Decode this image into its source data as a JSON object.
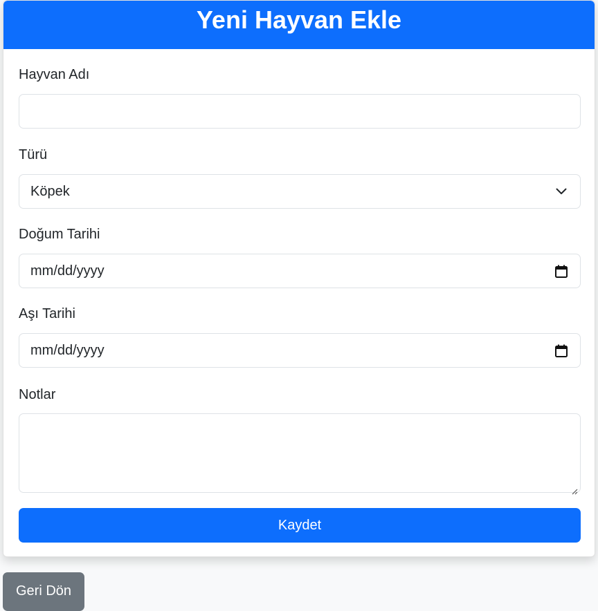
{
  "header": {
    "title": "Yeni Hayvan Ekle"
  },
  "form": {
    "name": {
      "label": "Hayvan Adı",
      "value": ""
    },
    "species": {
      "label": "Türü",
      "selected": "Köpek",
      "icon": "chevron-down-icon"
    },
    "birth_date": {
      "label": "Doğum Tarihi",
      "placeholder": "mm/dd/yyyy",
      "icon": "calendar-icon"
    },
    "vaccine_date": {
      "label": "Aşı Tarihi",
      "placeholder": "mm/dd/yyyy",
      "icon": "calendar-icon"
    },
    "notes": {
      "label": "Notlar",
      "value": ""
    },
    "submit_label": "Kaydet"
  },
  "back_label": "Geri Dön",
  "colors": {
    "primary": "#0d6efd",
    "secondary": "#6c757d",
    "background": "#f8f9fa"
  }
}
